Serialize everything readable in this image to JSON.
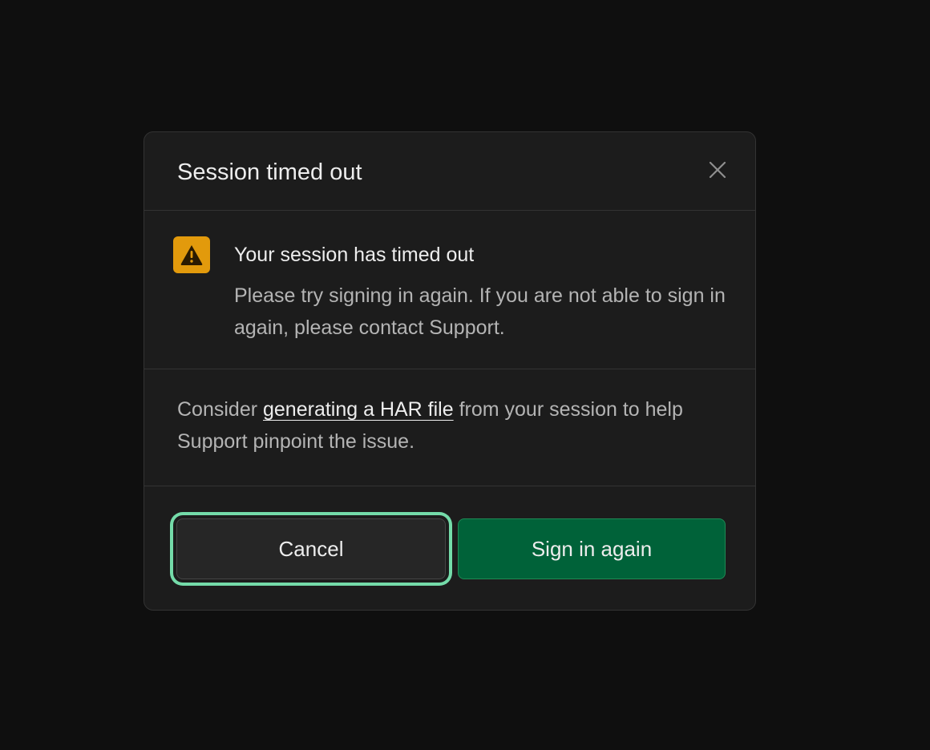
{
  "dialog": {
    "title": "Session timed out",
    "close_icon": "close-icon"
  },
  "alert": {
    "icon": "warning-triangle-icon",
    "title": "Your session has timed out",
    "description": "Please try signing in again. If you are not able to sign in again, please contact Support."
  },
  "info": {
    "prefix": "Consider ",
    "link_text": "generating a HAR file",
    "suffix": " from your session to help Support pinpoint the issue."
  },
  "buttons": {
    "cancel_label": "Cancel",
    "primary_label": "Sign in again"
  },
  "colors": {
    "background": "#0f0f0f",
    "dialog_bg": "#1c1c1c",
    "warning": "#e29a0c",
    "primary": "#006239",
    "focus_ring": "#74dba9"
  }
}
